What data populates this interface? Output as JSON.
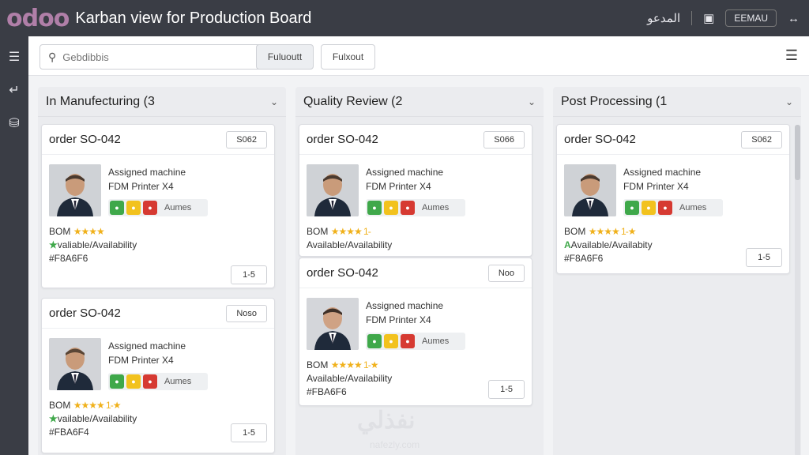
{
  "app": {
    "logo": "odoo",
    "title": "Karban view for Production Board",
    "top_right": {
      "icon1": "المدعو",
      "icon2": "▣",
      "user": "EEMAU",
      "icon3": "↔"
    }
  },
  "control": {
    "search_placeholder": "Gebdibbis",
    "btn_primary": "Fuluoutt",
    "btn_secondary": "Fulxout"
  },
  "columns": [
    {
      "title": "In Manufecturing (3",
      "cards": [
        {
          "order": "order SO-042",
          "ref": "S062",
          "assigned": "Assigned machine",
          "machine": "FDM Printer X4",
          "status": "Aumes",
          "bom": "BOM",
          "stars": "★★★★",
          "avail": "valiable/Availability",
          "hex": "#F8A6F6",
          "foot": "1-5"
        },
        {
          "order": "order SO-042",
          "ref": "Noso",
          "assigned": "Assigned machine",
          "machine": "FDM Printer X4",
          "status": "Aumes",
          "bom": "BOM",
          "stars": "★★★★ 1-★",
          "avail": "vailable/Availability",
          "hex": "#FBA6F4",
          "foot": "1-5"
        }
      ]
    },
    {
      "title": "Quality Review (2",
      "cards": [
        {
          "order": "order SO-042",
          "ref": "S066",
          "assigned": "Assigned machine",
          "machine": "FDM Printer X4",
          "status": "Aumes",
          "bom": "BOM",
          "stars": "★★★★ 1-",
          "avail": "Available/Availability",
          "hex": "",
          "foot": ""
        },
        {
          "order": "order SO-042",
          "ref": "Noo",
          "assigned": "Assigned machine",
          "machine": "FDM Printer X4",
          "status": "Aumes",
          "bom": "BOM",
          "stars": "★★★★ 1-★",
          "avail": "Available/Availability",
          "hex": "#FBA6F6",
          "foot": "1-5"
        }
      ]
    },
    {
      "title": "Post Processing (1",
      "cards": [
        {
          "order": "order SO-042",
          "ref": "S062",
          "assigned": "Assigned machine",
          "machine": "FDM Printer X4",
          "status": "Aumes",
          "bom": "BOM",
          "stars": "★★★★ 1-★",
          "avail": "Available/Availabity",
          "hex": "#F8A6F6",
          "foot": "1-5"
        }
      ]
    }
  ],
  "watermark": {
    "main": "نفذلي",
    "sub": "nafezly.com"
  },
  "colors": {
    "topbar": "#3a3d45",
    "green": "#3fa84a",
    "yellow": "#f2c21e",
    "red": "#d63a32",
    "star": "#f0b11b"
  },
  "icons": {
    "sidebar": [
      "menu-icon",
      "arrow-icon",
      "database-icon"
    ],
    "search": "search-icon",
    "menu": "hamburger-icon"
  }
}
